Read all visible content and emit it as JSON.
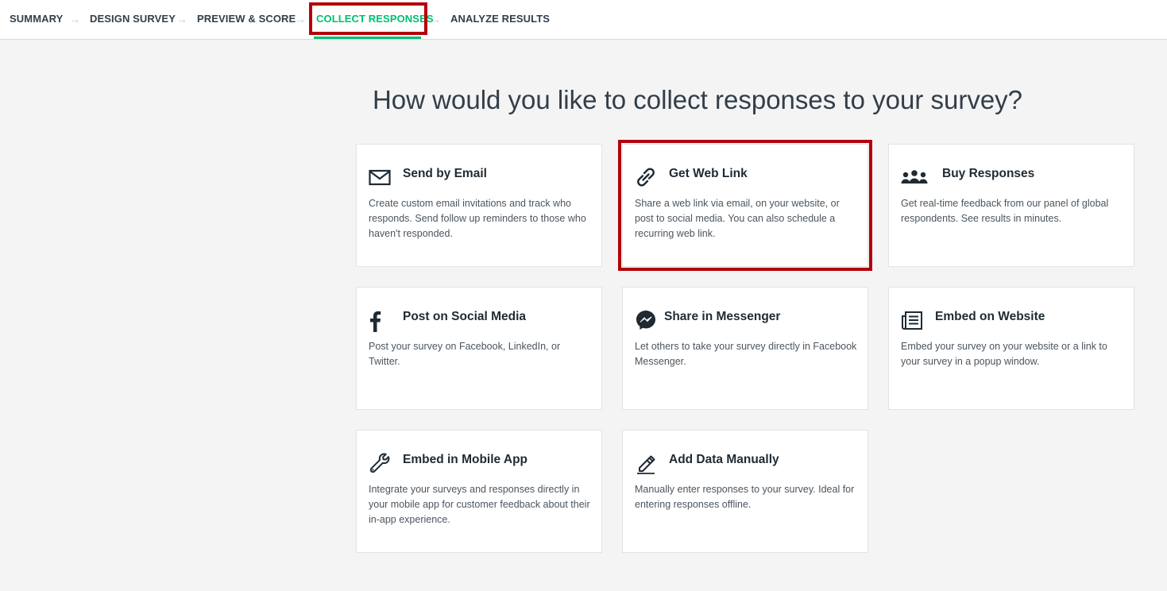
{
  "nav": {
    "steps": [
      {
        "label": "SUMMARY"
      },
      {
        "label": "DESIGN SURVEY"
      },
      {
        "label": "PREVIEW & SCORE"
      },
      {
        "label": "COLLECT RESPONSES"
      },
      {
        "label": "ANALYZE RESULTS"
      }
    ],
    "arrow": "→"
  },
  "main": {
    "title": "How would you like to collect responses to your survey?"
  },
  "cards": [
    {
      "title": "Send by Email",
      "desc": "Create custom email invitations and track who responds. Send follow up reminders to those who haven't responded."
    },
    {
      "title": "Get Web Link",
      "desc": "Share a web link via email, on your website, or post to social media. You can also schedule a recurring web link."
    },
    {
      "title": "Buy Responses",
      "desc": "Get real-time feedback from our panel of global respondents. See results in minutes."
    },
    {
      "title": "Post on Social Media",
      "desc": "Post your survey on Facebook, LinkedIn, or Twitter."
    },
    {
      "title": "Share in Messenger",
      "desc": "Let others to take your survey directly in Facebook Messenger."
    },
    {
      "title": "Embed on Website",
      "desc": "Embed your survey on your website or a link to your survey in a popup window."
    },
    {
      "title": "Embed in Mobile App",
      "desc": "Integrate your surveys and responses directly in your mobile app for customer feedback about their in-app experience."
    },
    {
      "title": "Add Data Manually",
      "desc": "Manually enter responses to your survey. Ideal for entering responses offline."
    }
  ],
  "colors": {
    "accent": "#00bf6f",
    "highlight": "#b3000c",
    "background": "#f4f4f4"
  }
}
